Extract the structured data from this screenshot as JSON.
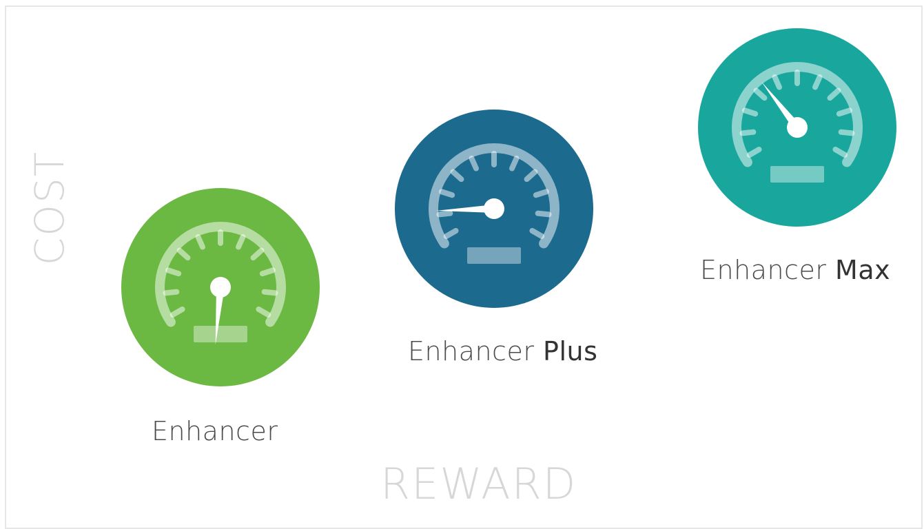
{
  "axes": {
    "y_label": "COST",
    "x_label": "REWARD"
  },
  "tiers": [
    {
      "id": "enhancer",
      "label_base": "Enhancer",
      "label_emph": "",
      "color": "#6bb843",
      "icon": "speedometer-low-icon"
    },
    {
      "id": "enhancer-plus",
      "label_base": "Enhancer",
      "label_emph": "Plus",
      "color": "#1c6a8e",
      "icon": "speedometer-mid-icon"
    },
    {
      "id": "enhancer-max",
      "label_base": "Enhancer",
      "label_emph": "Max",
      "color": "#19a79d",
      "icon": "speedometer-high-icon"
    }
  ]
}
